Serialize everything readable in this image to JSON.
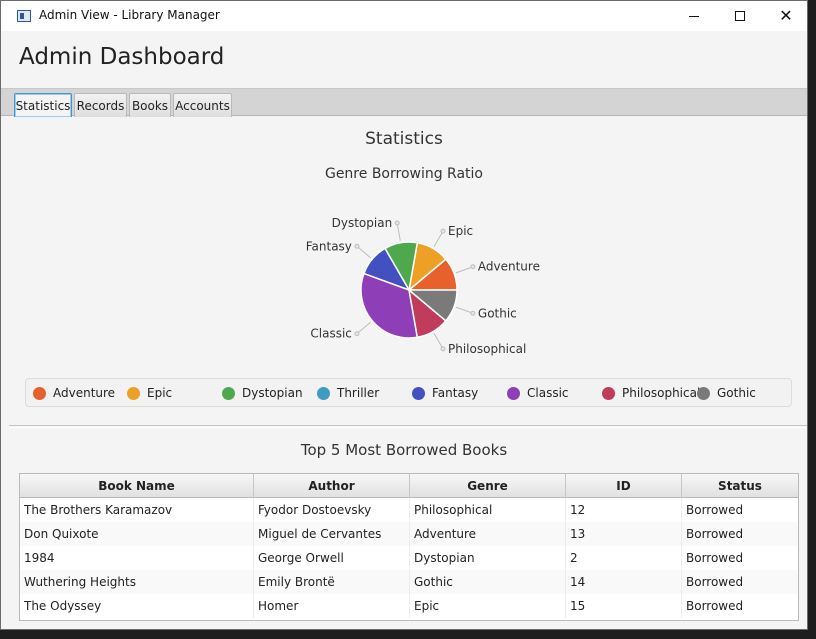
{
  "window": {
    "title": "Admin View - Library Manager"
  },
  "header": {
    "title": "Admin Dashboard"
  },
  "tabs": [
    {
      "label": "Statistics"
    },
    {
      "label": "Records"
    },
    {
      "label": "Books"
    },
    {
      "label": "Accounts"
    }
  ],
  "statistics": {
    "title": "Statistics"
  },
  "chart_data": {
    "type": "pie",
    "title": "Genre Borrowing Ratio",
    "series": [
      {
        "name": "Adventure",
        "value": 1,
        "color": "#e8602c"
      },
      {
        "name": "Epic",
        "value": 1,
        "color": "#eda026"
      },
      {
        "name": "Dystopian",
        "value": 1,
        "color": "#4ea84e"
      },
      {
        "name": "Thriller",
        "value": 0,
        "color": "#3e9bc1"
      },
      {
        "name": "Fantasy",
        "value": 1,
        "color": "#4250c2"
      },
      {
        "name": "Classic",
        "value": 3,
        "color": "#8e3fb8"
      },
      {
        "name": "Philosophical",
        "value": 1,
        "color": "#c13b5c"
      },
      {
        "name": "Gothic",
        "value": 1,
        "color": "#7a7a7a"
      }
    ],
    "slice_labels": [
      "Classic",
      "Philosophical",
      "Gothic",
      "Adventure",
      "Epic",
      "Dystopian",
      "Fantasy"
    ]
  },
  "top5": {
    "title": "Top 5 Most Borrowed Books",
    "columns": [
      "Book Name",
      "Author",
      "Genre",
      "ID",
      "Status"
    ],
    "rows": [
      [
        "The Brothers Karamazov",
        "Fyodor Dostoevsky",
        "Philosophical",
        "12",
        "Borrowed"
      ],
      [
        "Don Quixote",
        "Miguel de Cervantes",
        "Adventure",
        "13",
        "Borrowed"
      ],
      [
        "1984",
        "George Orwell",
        "Dystopian",
        "2",
        "Borrowed"
      ],
      [
        "Wuthering Heights",
        "Emily Brontë",
        "Gothic",
        "14",
        "Borrowed"
      ],
      [
        "The Odyssey",
        "Homer",
        "Epic",
        "15",
        "Borrowed"
      ]
    ]
  }
}
